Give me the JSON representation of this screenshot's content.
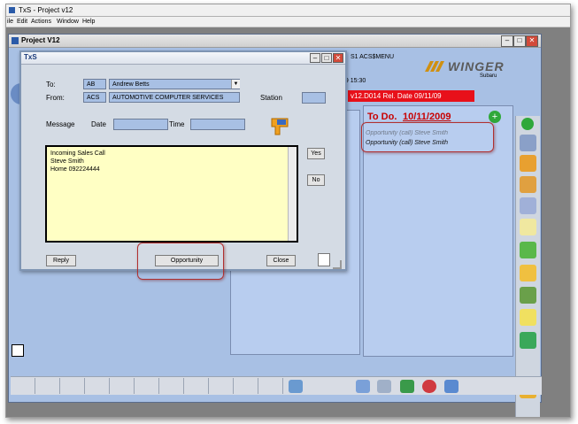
{
  "app": {
    "title": "TxS  - Project v12"
  },
  "menu": [
    "ile",
    "Edit",
    "Actions",
    "Window",
    "Help"
  ],
  "child": {
    "title": "Project V12",
    "menu_code": "S1  ACS$MENU",
    "time": "09  15:30",
    "version": "v12.D014  Rel. Date 09/11/09"
  },
  "logo": {
    "name": "WINGER",
    "sub": "Subaru"
  },
  "todo": {
    "title_prefix": "To Do.",
    "date": "10/11/2009",
    "items": [
      "Opportunity (call) Steve Smith",
      "Opportunity (call) Steve Smith"
    ]
  },
  "dialog": {
    "title": "TxS",
    "to_label": "To:",
    "to_code": "AB",
    "to_name": "Andrew Betts",
    "from_label": "From:",
    "from_code": "ACS",
    "from_name": "AUTOMOTIVE COMPUTER SERVICES",
    "station_label": "Station",
    "station_value": "",
    "message_label": "Message",
    "date_label": "Date",
    "date_value": "",
    "time_label": "Time",
    "time_value": "",
    "message_lines": [
      "Incoming Sales Call",
      "Steve Smith",
      "Home 092224444"
    ],
    "yes_label": "Yes",
    "no_label": "No",
    "reply_label": "Reply",
    "opportunity_label": "Opportunity",
    "close_label": "Close"
  },
  "colors": {
    "accent_red": "#e8101a",
    "panel_blue": "#a8c0e4",
    "note_yellow": "#ffffc4"
  }
}
